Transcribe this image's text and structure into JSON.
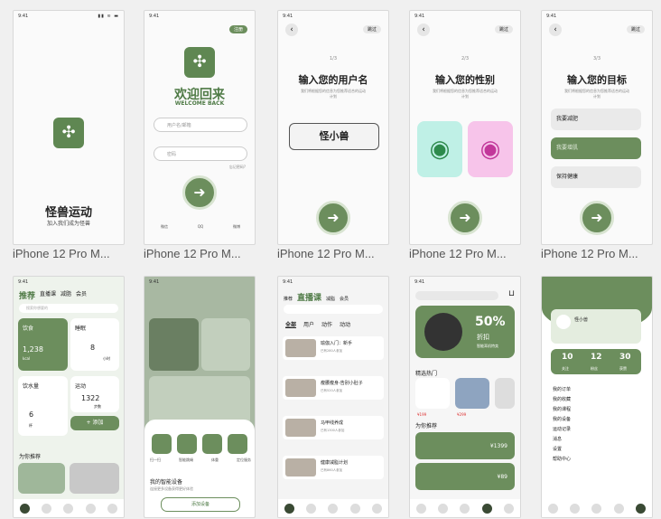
{
  "captions": [
    "iPhone 12 Pro M...",
    "iPhone 12 Pro M...",
    "iPhone 12 Pro M...",
    "iPhone 12 Pro M...",
    "iPhone 12 Pro M..."
  ],
  "status": {
    "time": "9:41",
    "icons": "▮▮ ≋ ▬"
  },
  "s1": {
    "title": "怪兽运动",
    "slogan": "加入我们成为怪兽"
  },
  "s2": {
    "skip": "注册",
    "title": "欢迎回来",
    "subtitle": "WELCOME BACK",
    "user_ph": "用户名/邮箱",
    "pwd_ph": "密码",
    "forgot": "忘记密码?",
    "social": [
      "微信",
      "QQ",
      "微博"
    ]
  },
  "s3": {
    "step": "1/3",
    "title": "输入您的用户名",
    "desc": "我们将根据您的信息为您推荐适合的运动计划",
    "value": "怪小兽",
    "skip": "跳过"
  },
  "s4": {
    "step": "2/3",
    "title": "输入您的性别",
    "desc": "我们将根据您的信息为您推荐适合的运动计划",
    "skip": "跳过"
  },
  "s5": {
    "step": "3/3",
    "title": "输入您的目标",
    "desc": "我们将根据您的信息为您推荐适合的运动计划",
    "skip": "跳过",
    "goals": [
      "我要减肥",
      "我要增肌",
      "保持健康"
    ]
  },
  "s6": {
    "tabs": [
      "推荐",
      "直播课",
      "减脂",
      "会员"
    ],
    "search": "搜索你想要的",
    "diet": "饮食",
    "diet_val": "1,238",
    "diet_unit": "kcal",
    "sleep": "睡眠",
    "sleep_val": "8",
    "sleep_unit": "小时",
    "water": "饮水量",
    "water_val": "6",
    "water_unit": "杯",
    "sport": "运动",
    "sport_val": "1322",
    "sport_unit": "步数",
    "add": "+ 添加",
    "rec": "为你推荐"
  },
  "s7": {
    "devices": [
      "扫一扫",
      "智能跳绳",
      "体重",
      "定位服务"
    ],
    "mine": "我的智能设备",
    "hint": "连接更多设备获得更好体验",
    "add": "添加设备"
  },
  "s8": {
    "tabs": [
      "推荐",
      "直播课",
      "减脂",
      "会员"
    ],
    "sub": [
      "全部",
      "用户",
      "动作",
      "动动"
    ],
    "items": [
      {
        "t": "瑜伽入门：新手",
        "m": "已有280人参加"
      },
      {
        "t": "瘦腰瘦身-告别小肚子",
        "m": "已有520人参加"
      },
      {
        "t": "马甲线养成",
        "m": "已有1300人参加"
      },
      {
        "t": "健康减脂计划",
        "m": "已有860人参加"
      }
    ]
  },
  "s9": {
    "pct": "50%",
    "off": "折扣",
    "sub": "智能耳机特卖",
    "hot": "精选热门",
    "rec": "为你推荐",
    "p1": "¥1399",
    "p2": "¥89",
    "p3": "¥199",
    "p4": "¥299"
  },
  "s10": {
    "name": "怪小兽",
    "stats": [
      "10",
      "12",
      "30"
    ],
    "stat_labels": [
      "关注",
      "粉丝",
      "获赞"
    ],
    "menu": [
      "我的订单",
      "我的收藏",
      "我的课程",
      "我的设备",
      "运动记录",
      "消息",
      "设置",
      "帮助中心"
    ]
  }
}
